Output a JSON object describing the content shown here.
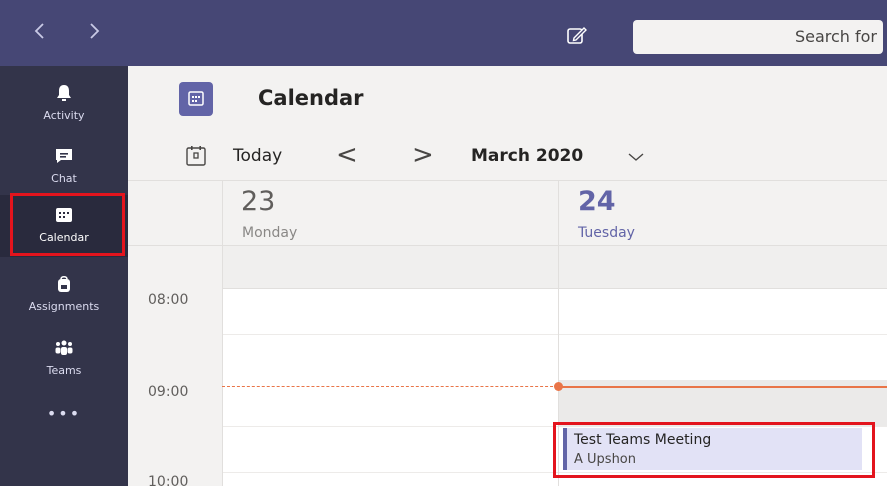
{
  "titlebar": {
    "back_icon": "chevron-left-icon",
    "forward_icon": "chevron-right-icon",
    "compose_icon": "compose-icon",
    "search_placeholder": "Search for"
  },
  "rail": {
    "items": [
      {
        "label": "Activity",
        "icon": "bell-icon"
      },
      {
        "label": "Chat",
        "icon": "chat-icon"
      },
      {
        "label": "Calendar",
        "icon": "calendar-icon",
        "active": true
      },
      {
        "label": "Assignments",
        "icon": "backpack-icon"
      },
      {
        "label": "Teams",
        "icon": "teams-icon"
      }
    ],
    "more_label": "•••"
  },
  "header": {
    "title": "Calendar"
  },
  "toolbar": {
    "today_label": "Today",
    "prev_label": "<",
    "next_label": ">",
    "month_label": "March 2020"
  },
  "days": [
    {
      "number": "23",
      "name": "Monday"
    },
    {
      "number": "24",
      "name": "Tuesday",
      "today": true
    }
  ],
  "times": [
    "08:00",
    "09:00",
    "10:00"
  ],
  "event": {
    "title": "Test Teams Meeting",
    "organizer": "A Upshon"
  },
  "colors": {
    "titlebar": "#464775",
    "rail": "#33344a",
    "accent": "#6264a7",
    "now_line": "#e97548",
    "highlight": "#e3141d"
  }
}
